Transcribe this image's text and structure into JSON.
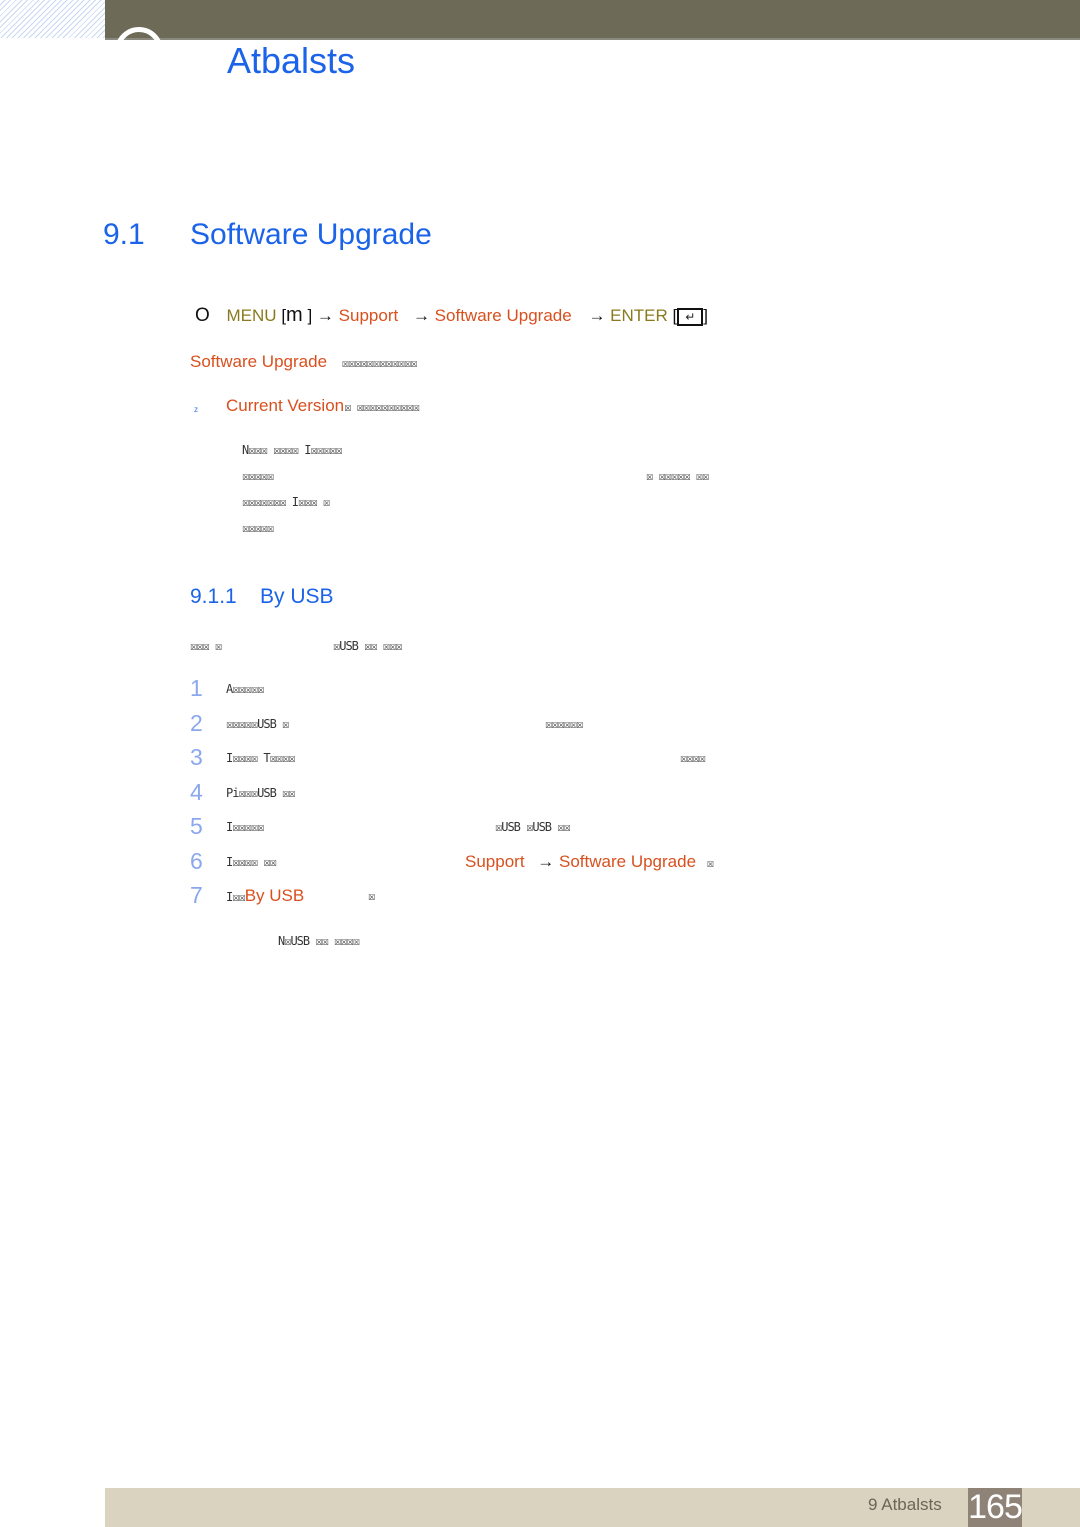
{
  "header": {
    "chapter_title": "Atbalsts"
  },
  "section": {
    "number": "9.1",
    "title": "Software Upgrade",
    "menu_path": {
      "bullet": "O",
      "menu_label": "MENU",
      "menu_key": "m",
      "steps": [
        "Support",
        "Software Upgrade"
      ],
      "enter_label": "ENTER",
      "arrow": "→",
      "bracket_open": "[",
      "bracket_close": "]"
    },
    "intro": {
      "highlight": "Software Upgrade",
      "text": "☒☒☒☒☒☒☒☒☒☒☒☒"
    },
    "current_version": {
      "bullet": "z",
      "highlight": "Current Version",
      "text": "☒ ☒☒☒☒☒☒☒☒☒☒"
    },
    "notes": [
      {
        "left": "N☒☒☒ ☒☒☒☒ I☒☒☒☒☒",
        "right": ""
      },
      {
        "left": "☒☒☒☒☒",
        "right": "☒ ☒☒☒☒☒ ☒☒"
      },
      {
        "left": "☒☒☒☒☒☒☒ I☒☒☒ ☒",
        "right": ""
      },
      {
        "left": "☒☒☒☒☒",
        "right": ""
      }
    ]
  },
  "subsection": {
    "number": "9.1.1",
    "title": "By USB",
    "intro_left": "☒☒☒ ☒",
    "intro_right": "☒USB ☒☒ ☒☒☒",
    "steps": [
      {
        "num": "1",
        "left": "A☒☒☒☒☒",
        "right": ""
      },
      {
        "num": "2",
        "left": "☒☒☒☒☒USB ☒",
        "right": "☒☒☒☒☒☒"
      },
      {
        "num": "3",
        "left": "I☒☒☒☒ T☒☒☒☒",
        "right": "☒☒☒☒"
      },
      {
        "num": "4",
        "left": "Pi☒☒☒USB ☒☒",
        "right": ""
      },
      {
        "num": "5",
        "left": "I☒☒☒☒☒",
        "right": "☒USB ☒USB ☒☒"
      },
      {
        "num": "6",
        "left": "I☒☒☒☒ ☒☒",
        "right_support": "Support",
        "right_upgrade": "Software Upgrade",
        "right_tail": "☒"
      },
      {
        "num": "7",
        "left": "I☒☒",
        "highlight": "By USB",
        "tail": "☒"
      }
    ],
    "note": "N☒USB ☒☒ ☒☒☒☒"
  },
  "footer": {
    "chapter_label": "9 Atbalsts",
    "page_number": "165"
  },
  "colors": {
    "heading_blue": "#1b63e8",
    "highlight_orange": "#d9501f",
    "menu_gold": "#8a7a1e",
    "top_bar": "#6d6b58",
    "footer_bar": "#d9d3bf",
    "page_box": "#8f8377",
    "step_number": "#8aa8ee"
  }
}
